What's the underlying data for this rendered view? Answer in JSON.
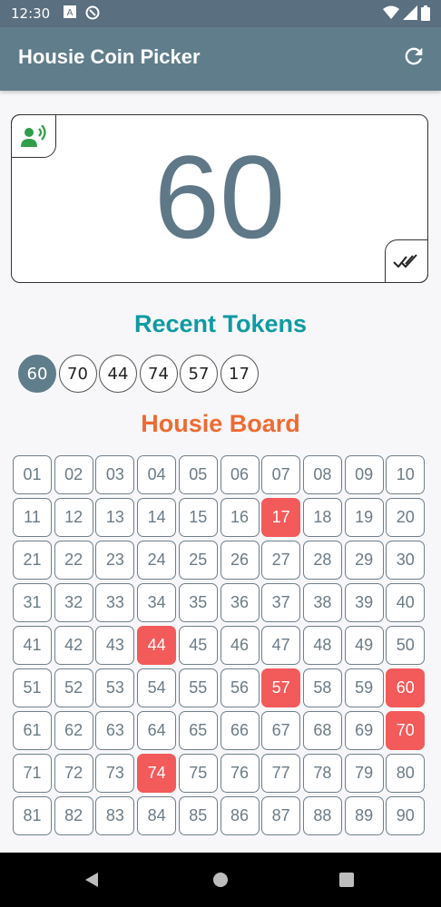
{
  "status_bar": {
    "time": "12:30"
  },
  "app": {
    "title": "Housie Coin Picker"
  },
  "current": {
    "number": "60"
  },
  "recent": {
    "title": "Recent Tokens",
    "tokens": [
      "60",
      "70",
      "44",
      "74",
      "57",
      "17"
    ]
  },
  "board": {
    "title": "Housie Board",
    "numbers": [
      "01",
      "02",
      "03",
      "04",
      "05",
      "06",
      "07",
      "08",
      "09",
      "10",
      "11",
      "12",
      "13",
      "14",
      "15",
      "16",
      "17",
      "18",
      "19",
      "20",
      "21",
      "22",
      "23",
      "24",
      "25",
      "26",
      "27",
      "28",
      "29",
      "30",
      "31",
      "32",
      "33",
      "34",
      "35",
      "36",
      "37",
      "38",
      "39",
      "40",
      "41",
      "42",
      "43",
      "44",
      "45",
      "46",
      "47",
      "48",
      "49",
      "50",
      "51",
      "52",
      "53",
      "54",
      "55",
      "56",
      "57",
      "58",
      "59",
      "60",
      "61",
      "62",
      "63",
      "64",
      "65",
      "66",
      "67",
      "68",
      "69",
      "70",
      "71",
      "72",
      "73",
      "74",
      "75",
      "76",
      "77",
      "78",
      "79",
      "80",
      "81",
      "82",
      "83",
      "84",
      "85",
      "86",
      "87",
      "88",
      "89",
      "90"
    ],
    "drawn": [
      "17",
      "44",
      "57",
      "60",
      "70",
      "74"
    ]
  },
  "colors": {
    "app_bar": "#607d8b",
    "recent_title": "#0f9aa3",
    "board_title": "#ee6b33",
    "drawn_cell": "#f35a5a",
    "speaker_icon": "#2e9e48"
  },
  "icons": {
    "refresh": "refresh-icon",
    "speaker": "record-voice-icon",
    "check": "done-all-icon",
    "nav_back": "back-triangle-icon",
    "nav_home": "home-circle-icon",
    "nav_recents": "recents-square-icon"
  }
}
